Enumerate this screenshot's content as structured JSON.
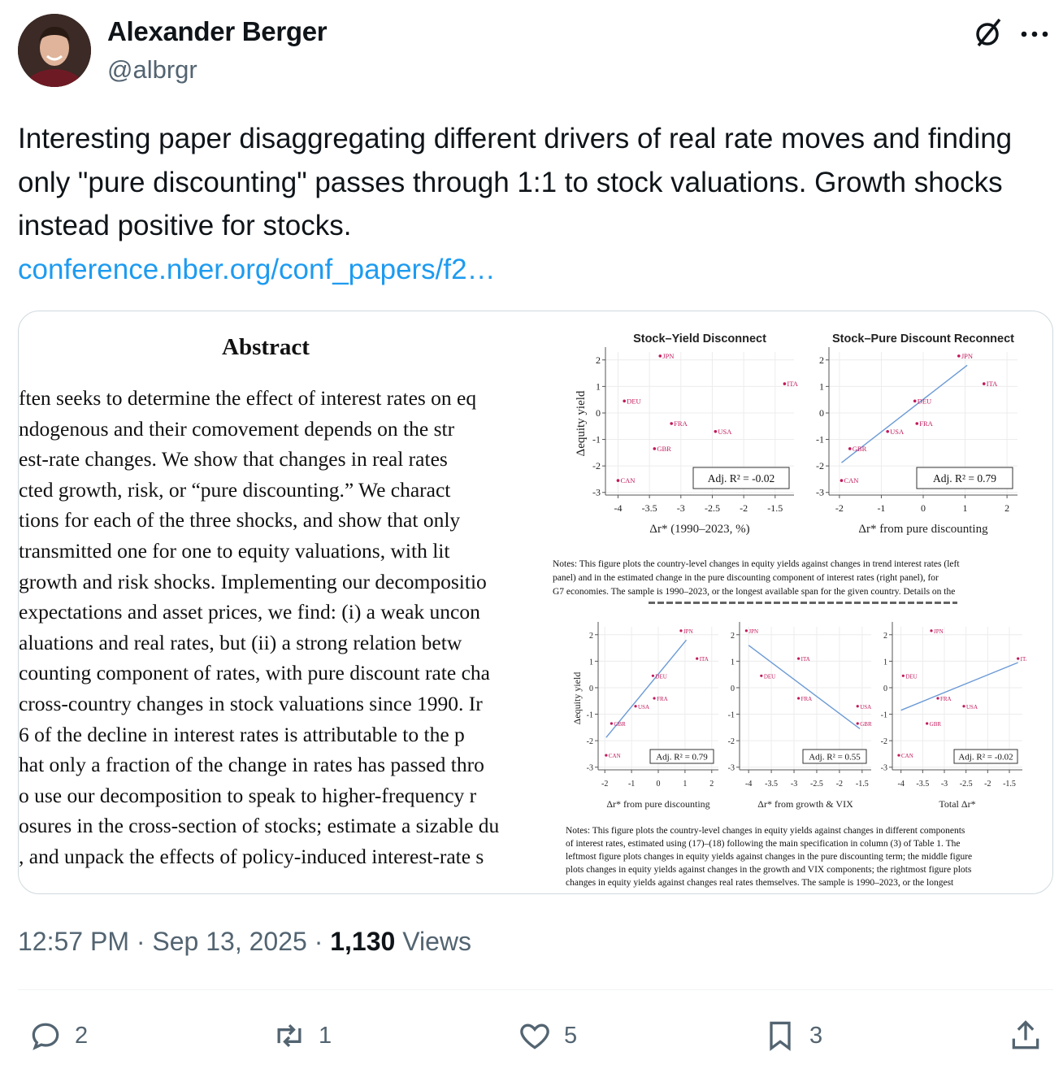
{
  "author": {
    "name": "Alexander Berger",
    "handle": "@albrgr"
  },
  "tweet": {
    "text": "Interesting paper disaggregating different drivers of real rate moves and finding only \"pure discounting\" passes through 1:1 to stock valuations. Growth shocks instead positive for stocks.",
    "link": "conference.nber.org/conf_papers/f2…"
  },
  "paper": {
    "abstract_title": "Abstract",
    "abstract_lines": [
      "ften seeks to determine the effect of interest rates on eq",
      "ndogenous and their comovement depends on the str",
      "est-rate changes.  We show that changes in real rates",
      "cted growth, risk, or “pure discounting.”  We charact",
      "tions for each of the three shocks, and show that only",
      " transmitted one for one to equity valuations, with lit",
      "growth and risk shocks.  Implementing our decompositio",
      "expectations and asset prices, we find:  (i) a weak uncon",
      "aluations and real rates, but (ii) a strong relation betw",
      "counting component of rates, with pure discount rate cha",
      "cross-country changes in stock valuations since 1990.  Ir",
      "6 of the decline in interest rates is attributable to the p",
      "hat only a fraction of the change in rates has passed thro",
      "o use our decomposition to speak to higher-frequency r",
      "osures in the cross-section of stocks; estimate a sizable du",
      ", and unpack the effects of policy-induced interest-rate s"
    ],
    "fig1_notes": [
      "Notes:  This figure plots the country-level changes in equity yields against changes in trend interest rates (left",
      "panel) and in the estimated change in the pure discounting component of interest rates (right panel), for",
      "G7 economies.  The sample is 1990–2023, or the longest available span for the given country.  Details on the"
    ],
    "fig2_notes": [
      "Notes:  This figure plots the country-level changes in equity yields against changes in different components",
      "of interest rates, estimated using (17)–(18) following the main specification in column (3) of Table 1.  The",
      "leftmost figure plots changes in equity yields against changes in the pure discounting term; the middle figure",
      "plots changes in equity yields against changes in the growth and VIX components; the rightmost figure plots",
      "changes in equity yields against changes real rates themselves.  The sample is 1990–2023, or the longest"
    ]
  },
  "chart_data": [
    {
      "type": "scatter",
      "title": "Stock–Yield Disconnect",
      "xlabel": "Δr* (1990–2023, %)",
      "ylabel": "Δequity yield",
      "xticks": [
        "-4",
        "-3.5",
        "-3",
        "-2.5",
        "-2",
        "-1.5"
      ],
      "yticks": [
        "-3",
        "-2",
        "-1",
        "0",
        "1",
        "2"
      ],
      "xlim": [
        -4.2,
        -1.2
      ],
      "ylim": [
        -3.1,
        2.3
      ],
      "points": [
        {
          "label": "JPN",
          "x": -3.33,
          "y": 2.15
        },
        {
          "label": "ITA",
          "x": -1.35,
          "y": 1.1
        },
        {
          "label": "DEU",
          "x": -3.9,
          "y": 0.45
        },
        {
          "label": "FRA",
          "x": -3.15,
          "y": -0.4
        },
        {
          "label": "USA",
          "x": -2.45,
          "y": -0.7
        },
        {
          "label": "GBR",
          "x": -3.42,
          "y": -1.35
        },
        {
          "label": "CAN",
          "x": -4.0,
          "y": -2.55
        }
      ],
      "fit": null,
      "annotation": "Adj. R² = -0.02"
    },
    {
      "type": "scatter",
      "title": "Stock–Pure Discount Reconnect",
      "xlabel": "Δr* from pure discounting",
      "ylabel": "",
      "xticks": [
        "-2",
        "-1",
        "0",
        "1",
        "2"
      ],
      "yticks": [
        "-3",
        "-2",
        "-1",
        "0",
        "1",
        "2"
      ],
      "xlim": [
        -2.25,
        2.25
      ],
      "ylim": [
        -3.1,
        2.3
      ],
      "points": [
        {
          "label": "JPN",
          "x": 0.85,
          "y": 2.15
        },
        {
          "label": "ITA",
          "x": 1.45,
          "y": 1.1
        },
        {
          "label": "DEU",
          "x": -0.2,
          "y": 0.45
        },
        {
          "label": "FRA",
          "x": -0.15,
          "y": -0.4
        },
        {
          "label": "USA",
          "x": -0.85,
          "y": -0.7
        },
        {
          "label": "GBR",
          "x": -1.75,
          "y": -1.35
        },
        {
          "label": "CAN",
          "x": -1.95,
          "y": -2.55
        }
      ],
      "fit": [
        [
          -1.95,
          -1.88
        ],
        [
          1.05,
          1.8
        ]
      ],
      "annotation": "Adj. R² = 0.79"
    },
    {
      "type": "scatter",
      "title": "",
      "xlabel": "Δr* from pure discounting",
      "ylabel": "Δequity yield",
      "xticks": [
        "-2",
        "-1",
        "0",
        "1",
        "2"
      ],
      "yticks": [
        "-3",
        "-2",
        "-1",
        "0",
        "1",
        "2"
      ],
      "xlim": [
        -2.25,
        2.25
      ],
      "ylim": [
        -3.1,
        2.3
      ],
      "points": [
        {
          "label": "JPN",
          "x": 0.85,
          "y": 2.15
        },
        {
          "label": "ITA",
          "x": 1.45,
          "y": 1.1
        },
        {
          "label": "DEU",
          "x": -0.2,
          "y": 0.45
        },
        {
          "label": "FRA",
          "x": -0.15,
          "y": -0.4
        },
        {
          "label": "USA",
          "x": -0.85,
          "y": -0.7
        },
        {
          "label": "GBR",
          "x": -1.75,
          "y": -1.35
        },
        {
          "label": "CAN",
          "x": -1.95,
          "y": -2.55
        }
      ],
      "fit": [
        [
          -1.95,
          -1.88
        ],
        [
          1.05,
          1.8
        ]
      ],
      "annotation": "Adj. R² = 0.79"
    },
    {
      "type": "scatter",
      "title": "",
      "xlabel": "Δr* from growth & VIX",
      "ylabel": "",
      "xticks": [
        "-4",
        "-3.5",
        "-3",
        "-2.5",
        "-2",
        "-1.5"
      ],
      "yticks": [
        "-3",
        "-2",
        "-1",
        "0",
        "1",
        "2"
      ],
      "xlim": [
        -4.2,
        -1.3
      ],
      "ylim": [
        -3.1,
        2.3
      ],
      "points": [
        {
          "label": "JPN",
          "x": -4.05,
          "y": 2.15
        },
        {
          "label": "ITA",
          "x": -2.9,
          "y": 1.1
        },
        {
          "label": "DEU",
          "x": -3.72,
          "y": 0.45
        },
        {
          "label": "FRA",
          "x": -2.9,
          "y": -0.4
        },
        {
          "label": "USA",
          "x": -1.6,
          "y": -0.7
        },
        {
          "label": "GBR",
          "x": -1.6,
          "y": -1.35
        },
        {
          "label": "CAN",
          "x": -2.05,
          "y": -2.55
        }
      ],
      "fit": [
        [
          -4.0,
          1.6
        ],
        [
          -1.55,
          -1.55
        ]
      ],
      "annotation": "Adj. R² = 0.55"
    },
    {
      "type": "scatter",
      "title": "",
      "xlabel": "Total Δr*",
      "ylabel": "",
      "xticks": [
        "-4",
        "-3.5",
        "-3",
        "-2.5",
        "-2",
        "-1.5"
      ],
      "yticks": [
        "-3",
        "-2",
        "-1",
        "0",
        "1",
        "2"
      ],
      "xlim": [
        -4.2,
        -1.2
      ],
      "ylim": [
        -3.1,
        2.3
      ],
      "points": [
        {
          "label": "JPN",
          "x": -3.3,
          "y": 2.15
        },
        {
          "label": "ITA",
          "x": -1.3,
          "y": 1.1
        },
        {
          "label": "DEU",
          "x": -3.95,
          "y": 0.45
        },
        {
          "label": "FRA",
          "x": -3.15,
          "y": -0.4
        },
        {
          "label": "USA",
          "x": -2.55,
          "y": -0.7
        },
        {
          "label": "GBR",
          "x": -3.4,
          "y": -1.35
        },
        {
          "label": "CAN",
          "x": -4.05,
          "y": -2.55
        }
      ],
      "fit": [
        [
          -4.0,
          -0.85
        ],
        [
          -1.3,
          0.95
        ]
      ],
      "annotation": "Adj. R² = -0.02"
    }
  ],
  "meta": {
    "time": "12:57 PM",
    "date": "Sep 13, 2025",
    "views_count": "1,130",
    "views_label": "Views"
  },
  "actions": {
    "replies": "2",
    "reposts": "1",
    "likes": "5",
    "bookmarks": "3"
  },
  "colors": {
    "link": "#1d9bf0",
    "muted": "#536471",
    "marker": "#c2185b",
    "fit_line": "#6b9ad6"
  }
}
